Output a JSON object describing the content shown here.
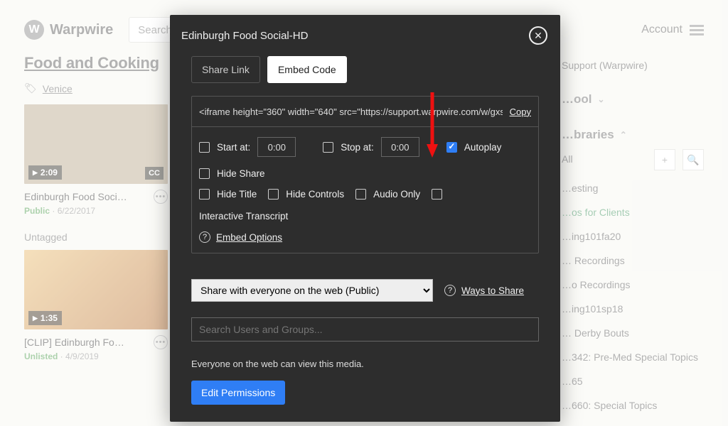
{
  "header": {
    "brand": "Warpwire",
    "search_placeholder": "Search",
    "account_label": "Account"
  },
  "page": {
    "title": "Food and Cooking",
    "tag": "Venice",
    "untagged_label": "Untagged"
  },
  "cards": [
    {
      "title": "Edinburgh Food Soci…",
      "duration": "2:09",
      "cc": "CC",
      "visibility": "Public",
      "date": "6/22/2017"
    },
    {
      "title": "[CLIP] Edinburgh Fo…",
      "duration": "1:35",
      "cc": "",
      "visibility": "Unlisted",
      "date": "4/9/2019"
    }
  ],
  "sidebar": {
    "crumb": "Support (Warpwire)",
    "section1": "…ool",
    "section2": "…braries",
    "all_label": "All",
    "items": [
      "…esting",
      "…os for Clients",
      "…ing101fa20",
      "… Recordings",
      "…o Recordings",
      "…ing101sp18",
      "… Derby Bouts",
      "…342: Pre-Med Special Topics",
      "…65",
      "…660: Special Topics"
    ]
  },
  "modal": {
    "title": "Edinburgh Food Social-HD",
    "tabs": {
      "share_link": "Share Link",
      "embed_code": "Embed Code"
    },
    "embed_value": "<iframe height=\"360\" width=\"640\" src=\"https://support.warpwire.com/w/gxs/",
    "copy": "Copy",
    "start_at_label": "Start at:",
    "start_at_value": "0:00",
    "stop_at_label": "Stop at:",
    "stop_at_value": "0:00",
    "autoplay_label": "Autoplay",
    "hide_share_label": "Hide Share",
    "hide_title_label": "Hide Title",
    "hide_controls_label": "Hide Controls",
    "audio_only_label": "Audio Only",
    "interactive_transcript_label": "Interactive Transcript",
    "embed_options_label": "Embed Options",
    "share_select_value": "Share with everyone on the web (Public)",
    "ways_label": "Ways to Share",
    "search_users_placeholder": "Search Users and Groups...",
    "perm_text": "Everyone on the web can view this media.",
    "edit_perm": "Edit Permissions",
    "checked": {
      "autoplay": true
    }
  }
}
